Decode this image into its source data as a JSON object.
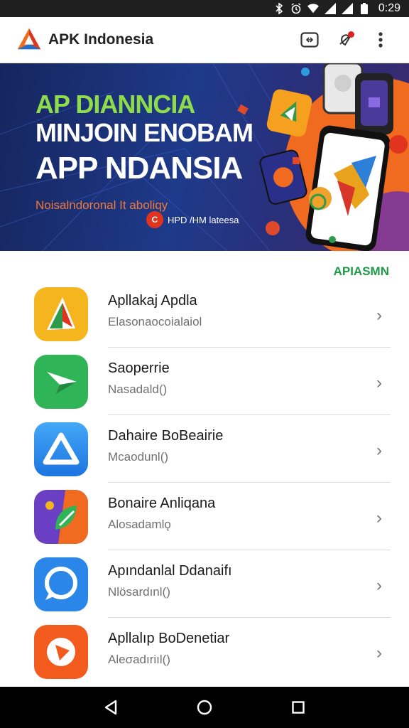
{
  "status_bar": {
    "time": "0:29",
    "icons": [
      "bluetooth-icon",
      "alarm-icon",
      "wifi-icon",
      "signal-icon",
      "signal-icon",
      "battery-icon"
    ]
  },
  "app_bar": {
    "title": "APK Indonesia",
    "actions": [
      "cast-icon",
      "notification-bell-icon",
      "more-vert-icon"
    ]
  },
  "banner": {
    "headline": "AP DIANNCIA",
    "line2": "MINJOIN ENOBAM",
    "line3": "APP NDANSIA",
    "subtitle": "Noisalndoronal It aboliqy",
    "brand": "HPD /HM lateesa",
    "brand_badge": "C"
  },
  "section": {
    "label": "APIASMN"
  },
  "apps": [
    {
      "name": "Apllakaj Apdla",
      "subtitle": "Elasonaocoialaiol",
      "icon": "play-triangle-icon",
      "color": "#f5b51f"
    },
    {
      "name": "Saoperrie",
      "subtitle": "Nasadald()",
      "icon": "send-arrow-icon",
      "color": "#2fb457"
    },
    {
      "name": "Dahaire BoBeairie",
      "subtitle": "Mcaodunl()",
      "icon": "triangle-icon",
      "color": "#2b8ff0"
    },
    {
      "name": "Bonaire Anliqana",
      "subtitle": "Alosadamlǫ",
      "icon": "paint-leaf-icon",
      "color": "#6a3fc4"
    },
    {
      "name": "Apındanlal Ddanaifı",
      "subtitle": "Nlösardınl()",
      "icon": "chat-bubble-icon",
      "color": "#2a86e8"
    },
    {
      "name": "Apllalıp BoDenetiar",
      "subtitle": "Aleσadıriıl()",
      "icon": "play-arrow-icon",
      "color": "#f25a1e"
    }
  ],
  "chevron": "›",
  "nav_bar": [
    "back-icon",
    "home-icon",
    "recents-icon"
  ]
}
